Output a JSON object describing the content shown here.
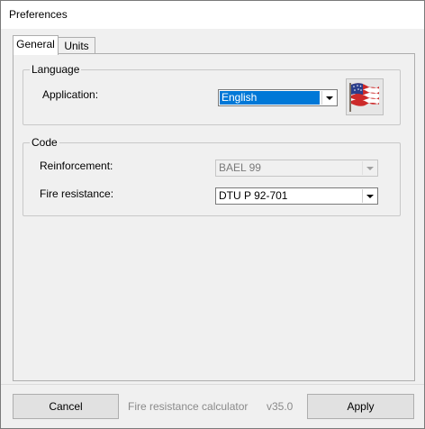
{
  "window": {
    "title": "Preferences"
  },
  "tabs": [
    {
      "label": "General"
    },
    {
      "label": "Units"
    }
  ],
  "language": {
    "legend": "Language",
    "application_label": "Application:",
    "application_value": "English",
    "flag_icon": "us-flag-icon"
  },
  "code": {
    "legend": "Code",
    "reinforcement_label": "Reinforcement:",
    "reinforcement_value": "BAEL 99",
    "fire_label": "Fire resistance:",
    "fire_value": "DTU P 92-701"
  },
  "footer": {
    "cancel_label": "Cancel",
    "app_name": "Fire resistance calculator",
    "version": "v35.0",
    "apply_label": "Apply"
  },
  "colors": {
    "selection": "#0078d7",
    "window_bg": "#f0f0f0"
  }
}
